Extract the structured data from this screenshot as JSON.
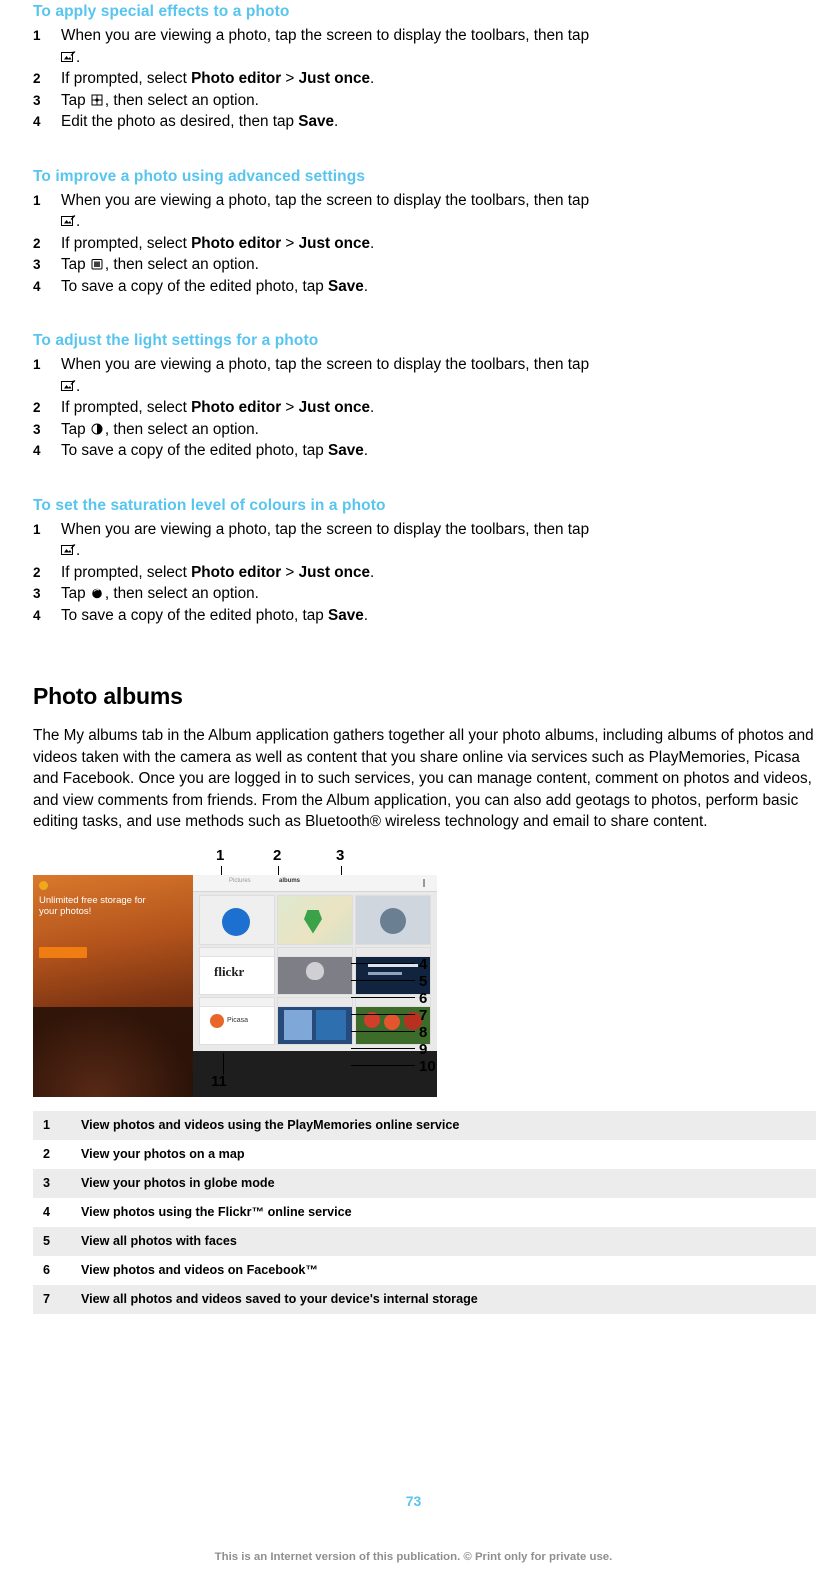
{
  "document": {
    "page_number": "73",
    "footer_note": "This is an Internet version of this publication. © Print only for private use."
  },
  "sections": [
    {
      "heading": "To apply special effects to a photo",
      "steps": [
        {
          "num": "1",
          "pre": "When you are viewing a photo, tap the screen to display the toolbars, then tap ",
          "icon": "photo-editor-icon",
          "post": "."
        },
        {
          "num": "2",
          "pre": "If prompted, select ",
          "bold1": "Photo editor",
          "mid": " > ",
          "bold2": "Just once",
          "post": "."
        },
        {
          "num": "3",
          "pre": "Tap ",
          "icon": "special-effects-icon",
          "post": ", then select an option."
        },
        {
          "num": "4",
          "pre": "Edit the photo as desired, then tap ",
          "bold1": "Save",
          "post": "."
        }
      ]
    },
    {
      "heading": "To improve a photo using advanced settings",
      "steps": [
        {
          "num": "1",
          "pre": "When you are viewing a photo, tap the screen to display the toolbars, then tap ",
          "icon": "photo-editor-icon",
          "post": "."
        },
        {
          "num": "2",
          "pre": "If prompted, select ",
          "bold1": "Photo editor",
          "mid": " > ",
          "bold2": "Just once",
          "post": "."
        },
        {
          "num": "3",
          "pre": "Tap ",
          "icon": "advanced-settings-icon",
          "post": ", then select an option."
        },
        {
          "num": "4",
          "pre": "To save a copy of the edited photo, tap ",
          "bold1": "Save",
          "post": "."
        }
      ]
    },
    {
      "heading": "To adjust the light settings for a photo",
      "steps": [
        {
          "num": "1",
          "pre": "When you are viewing a photo, tap the screen to display the toolbars, then tap ",
          "icon": "photo-editor-icon",
          "post": "."
        },
        {
          "num": "2",
          "pre": "If prompted, select ",
          "bold1": "Photo editor",
          "mid": " > ",
          "bold2": "Just once",
          "post": "."
        },
        {
          "num": "3",
          "pre": "Tap ",
          "icon": "light-settings-icon",
          "post": ", then select an option."
        },
        {
          "num": "4",
          "pre": "To save a copy of the edited photo, tap ",
          "bold1": "Save",
          "post": "."
        }
      ]
    },
    {
      "heading": "To set the saturation level of colours in a photo",
      "steps": [
        {
          "num": "1",
          "pre": "When you are viewing a photo, tap the screen to display the toolbars, then tap ",
          "icon": "photo-editor-icon",
          "post": "."
        },
        {
          "num": "2",
          "pre": "If prompted, select ",
          "bold1": "Photo editor",
          "mid": " > ",
          "bold2": "Just once",
          "post": "."
        },
        {
          "num": "3",
          "pre": "Tap ",
          "icon": "saturation-icon",
          "post": ", then select an option."
        },
        {
          "num": "4",
          "pre": "To save a copy of the edited photo, tap ",
          "bold1": "Save",
          "post": "."
        }
      ]
    }
  ],
  "photo_albums": {
    "title": "Photo albums",
    "paragraph": "The My albums tab in the Album application gathers together all your photo albums, including albums of photos and videos taken with the camera as well as content that you share online via services such as PlayMemories, Picasa and Facebook. Once you are logged in to such services, you can manage content, comment on photos and videos, and view comments from friends. From the Album application, you can also add geotags to photos, perform basic editing tasks, and use methods such as Bluetooth® wireless technology and email to share content."
  },
  "figure": {
    "callouts": [
      "1",
      "2",
      "3",
      "4",
      "5",
      "6",
      "7",
      "8",
      "9",
      "10",
      "11"
    ],
    "screenshot_text": {
      "ad_line1": "Unlimited free storage for",
      "ad_line2": "your photos!",
      "tab_left": "Pictures",
      "tab_right": "albums",
      "flickr_label": "flickr",
      "picasa_label": "Picasa"
    }
  },
  "legend_table": {
    "rows": [
      {
        "index": "1",
        "text": "View photos and videos using the PlayMemories online service"
      },
      {
        "index": "2",
        "text": "View your photos on a map"
      },
      {
        "index": "3",
        "text": "View your photos in globe mode"
      },
      {
        "index": "4",
        "text": "View photos using the Flickr™ online service"
      },
      {
        "index": "5",
        "text": "View all photos with faces"
      },
      {
        "index": "6",
        "text": "View photos and videos on Facebook™"
      },
      {
        "index": "7",
        "text": "View all photos and videos saved to your device's internal storage"
      }
    ]
  },
  "colors": {
    "heading_blue": "#57c5ef",
    "row_alt": "#ececec",
    "footer_grey": "#8f8f8f"
  }
}
